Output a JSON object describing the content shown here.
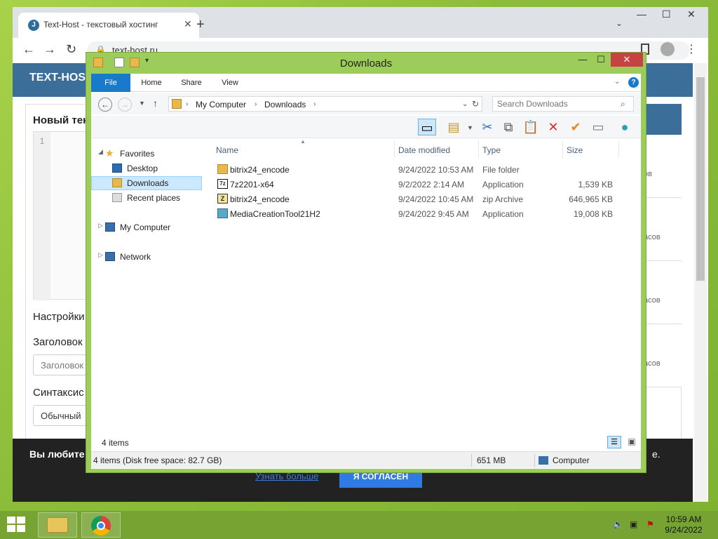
{
  "browser": {
    "tab_title": "Text-Host - текстовый хостинг",
    "url": "text-host.ru",
    "favicon_letter": "J"
  },
  "website": {
    "logo": "TEXT-HOST",
    "heading": "Новый тек",
    "line_number": "1",
    "settings_label": "Настройки",
    "title_label": "Заголовок",
    "title_placeholder": "Заголовок",
    "syntax_label": "Синтаксис",
    "syntax_value": "Обычный",
    "side_items": [
      "ов",
      "асов",
      "асов",
      "асов"
    ],
    "cookie_message": "Вы любите",
    "cookie_tail": "е.",
    "learn_more": "Узнать больше",
    "agree_button": "Я СОГЛАСЕН"
  },
  "explorer": {
    "title": "Downloads",
    "ribbon_tabs": [
      "File",
      "Home",
      "Share",
      "View"
    ],
    "address": {
      "root": "My Computer",
      "folder": "Downloads"
    },
    "search_placeholder": "Search Downloads",
    "nav": {
      "favorites": "Favorites",
      "desktop": "Desktop",
      "downloads": "Downloads",
      "recent": "Recent places",
      "computer": "My Computer",
      "network": "Network"
    },
    "columns": [
      "Name",
      "Date modified",
      "Type",
      "Size"
    ],
    "files": [
      {
        "name": "bitrix24_encode",
        "date": "9/24/2022 10:53 AM",
        "type": "File folder",
        "size": "",
        "icon": "folder-icon"
      },
      {
        "name": "7z2201-x64",
        "date": "9/2/2022 2:14 AM",
        "type": "Application",
        "size": "1,539 KB",
        "icon": "7zip-icon"
      },
      {
        "name": "bitrix24_encode",
        "date": "9/24/2022 10:45 AM",
        "type": "zip Archive",
        "size": "646,965 KB",
        "icon": "zip-icon"
      },
      {
        "name": "MediaCreationTool21H2",
        "date": "9/24/2022 9:45 AM",
        "type": "Application",
        "size": "19,008 KB",
        "icon": "media-tool-icon"
      }
    ],
    "item_count": "4 items",
    "status_left": "4 items (Disk free space: 82.7 GB)",
    "status_size": "651 MB",
    "status_location": "Computer"
  },
  "taskbar": {
    "time": "10:59 AM",
    "date": "9/24/2022"
  },
  "colors": {
    "explorer_frame": "#9ccc5a",
    "file_tab": "#1979ca",
    "selection": "#cce8ff",
    "close_button": "#c74343"
  }
}
